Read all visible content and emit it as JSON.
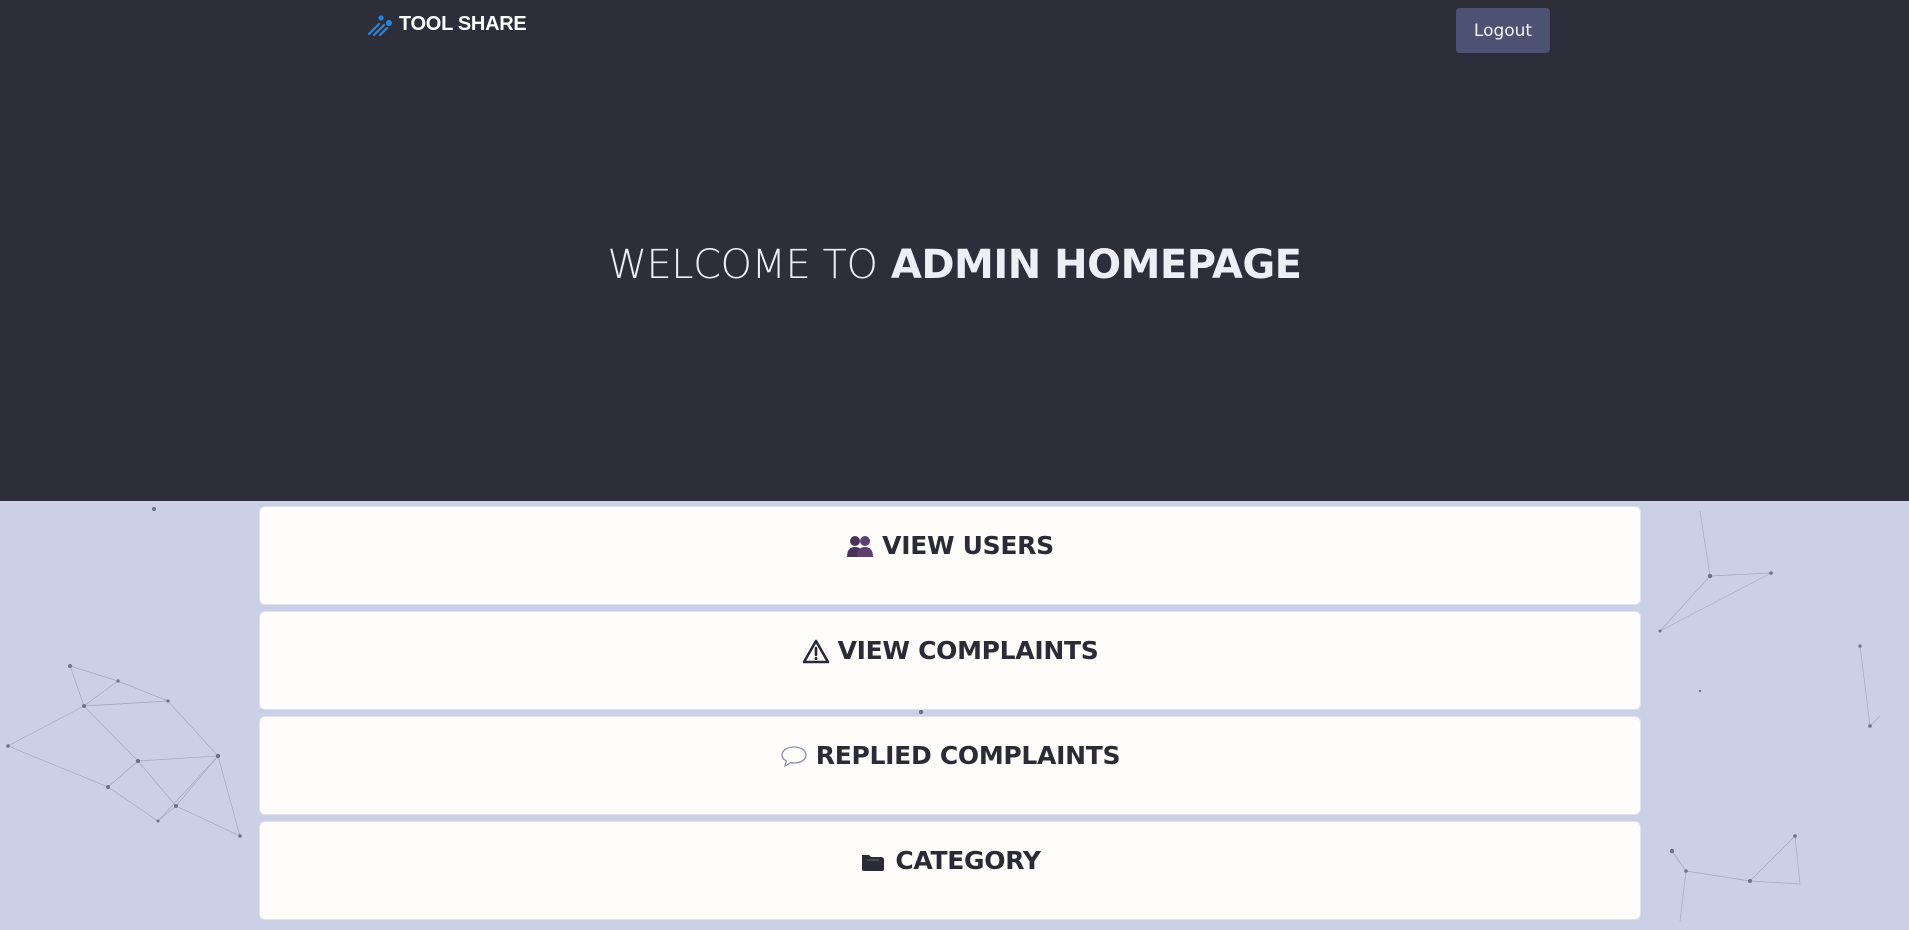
{
  "header": {
    "brand": "TOOL SHARE",
    "logout_label": "Logout"
  },
  "hero": {
    "welcome_prefix": "WELCOME TO",
    "welcome_emphasis": "ADMIN HOMEPAGE"
  },
  "menu": [
    {
      "label": "VIEW USERS",
      "icon": "users-icon"
    },
    {
      "label": "VIEW COMPLAINTS",
      "icon": "warning-icon"
    },
    {
      "label": "REPLIED COMPLAINTS",
      "icon": "speech-bubble-icon"
    },
    {
      "label": "CATEGORY",
      "icon": "folder-icon"
    }
  ],
  "colors": {
    "hero_bg": "#2e2e3a",
    "page_bg": "#cbd0e6",
    "button_bg": "#4e5272",
    "card_bg": "#fefdfb",
    "text_dark": "#2b2b36",
    "brand_accent": "#1e88e5"
  }
}
